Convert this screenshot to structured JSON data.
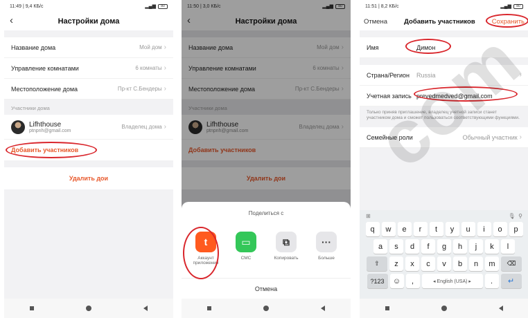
{
  "screen1": {
    "status_left": "11:49 | 9,4 КБ/с",
    "battery": "80",
    "title": "Настройки дома",
    "rows": [
      {
        "label": "Название дома",
        "value": "Мой дом"
      },
      {
        "label": "Управление комнатами",
        "value": "6 комнаты"
      },
      {
        "label": "Местоположение дома",
        "value": "Пр-кт С.Бендеры"
      }
    ],
    "members_label": "Участники дома",
    "member": {
      "name": "Lifhthouse",
      "email": "ptnpnh@gmail.com",
      "role": "Владелец дома"
    },
    "add_member": "Добавить участников",
    "delete_home": "Удалить дои"
  },
  "screen2": {
    "status_left": "11:50 | 3,0 КБ/с",
    "battery": "80",
    "title": "Настройки дома",
    "rows": [
      {
        "label": "Название дома",
        "value": "Мой дом"
      },
      {
        "label": "Управление комнатами",
        "value": "6 комнаты"
      },
      {
        "label": "Местоположение дома",
        "value": "Пр-кт С.Бендеры"
      }
    ],
    "members_label": "Участники дома",
    "member": {
      "name": "Lifhthouse",
      "email": "ptnpnh@gmail.com",
      "role": "Владелец дома"
    },
    "add_member": "Добавить участников",
    "delete_home": "Удалить дои",
    "share_title": "Поделиться с",
    "share_items": [
      {
        "label": "Аккаунт приложения",
        "icon": "t",
        "color": "#ff5a1f"
      },
      {
        "label": "СМС",
        "icon": "▭",
        "color": "#34c759"
      },
      {
        "label": "Копировать",
        "icon": "⧉",
        "color": "#e6e6e9"
      },
      {
        "label": "Больше",
        "icon": "···",
        "color": "#e6e6e9"
      }
    ],
    "cancel": "Отмена"
  },
  "screen3": {
    "status_left": "11:51 | 8,2 КБ/с",
    "battery": "80",
    "cancel": "Отмена",
    "title": "Добавить участников",
    "save": "Сохранить",
    "name_label": "Имя",
    "name_value": "Димон",
    "region_label": "Страна/Регион",
    "region_value": "Russia",
    "account_label": "Учетная запись",
    "account_value": "prevedmedved@gmail.com",
    "note": "Только приняв приглашение, владелец учетной записи станет участником дома и сможет пользоваться соответствующими функциями.",
    "roles_label": "Семейные роли",
    "roles_value": "Обычный участник",
    "kb_row1": [
      "q",
      "w",
      "e",
      "r",
      "t",
      "y",
      "u",
      "i",
      "o",
      "p"
    ],
    "kb_row2": [
      "a",
      "s",
      "d",
      "f",
      "g",
      "h",
      "j",
      "k",
      "l"
    ],
    "kb_row3": [
      "z",
      "x",
      "c",
      "v",
      "b",
      "n",
      "m"
    ],
    "kb_123": "?123",
    "kb_space": "◂ English (USA) ▸"
  },
  "watermark": "com"
}
